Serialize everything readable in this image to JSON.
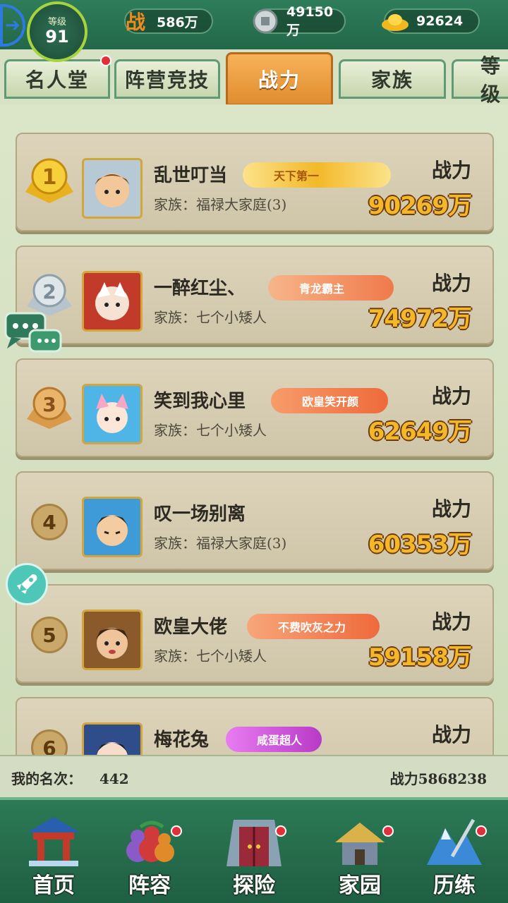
{
  "top": {
    "level_label": "等级",
    "level": "91",
    "power": "586万",
    "silver": "49150万",
    "gold": "92624",
    "power_icon_text": "战"
  },
  "tabs": [
    {
      "label": "名人堂"
    },
    {
      "label": "阵营竞技"
    },
    {
      "label": "战力"
    },
    {
      "label": "家族"
    },
    {
      "label": "等级"
    }
  ],
  "ranking": {
    "power_label": "战力",
    "rows": [
      {
        "rank": "1",
        "name": "乱世叮当",
        "family": "家族：福禄大家庭(3)",
        "title": "天下第一",
        "power": "90269万",
        "title_color": "#f0c23a"
      },
      {
        "rank": "2",
        "name": "一醉红尘、",
        "family": "家族：七个小矮人",
        "title": "青龙霸主",
        "power": "74972万",
        "title_color": "#f0845a"
      },
      {
        "rank": "3",
        "name": "笑到我心里",
        "family": "家族：七个小矮人",
        "title": "欧皇笑开颜",
        "power": "62649万",
        "title_color": "#f07a4c"
      },
      {
        "rank": "4",
        "name": "叹一场别离",
        "family": "家族：福禄大家庭(3)",
        "title": "",
        "power": "60353万",
        "title_color": ""
      },
      {
        "rank": "5",
        "name": "欧皇大佬",
        "family": "家族：七个小矮人",
        "title": "不费吹灰之力",
        "power": "59158万",
        "title_color": "#f06a3c"
      },
      {
        "rank": "6",
        "name": "梅花兔",
        "family": "",
        "title": "咸蛋超人",
        "power": "",
        "title_color": "#d45ad8"
      }
    ]
  },
  "my_rank": {
    "label": "我的名次：",
    "value": "442",
    "power_text": "战力5868238"
  },
  "nav": [
    {
      "label": "首页"
    },
    {
      "label": "阵容"
    },
    {
      "label": "探险"
    },
    {
      "label": "家园"
    },
    {
      "label": "历练"
    }
  ]
}
